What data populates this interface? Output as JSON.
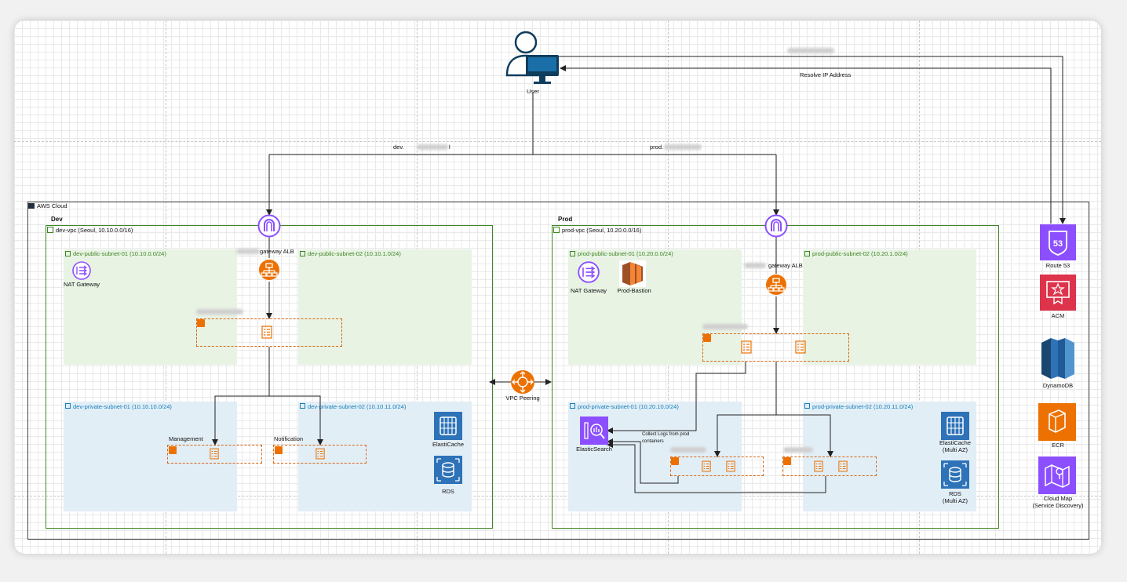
{
  "user": {
    "label": "User"
  },
  "edges": {
    "resolve_ip": "Resolve IP Address",
    "dev_domain": "dev.",
    "dev_domain_tail": "l",
    "prod_domain": "prod.",
    "collect_logs_line1": "Collect Logs from prod",
    "collect_logs_line2": "containers"
  },
  "aws_cloud": {
    "label": "AWS Cloud"
  },
  "dev": {
    "env_label": "Dev",
    "vpc_label": "dev-vpc (Seoul, 10.10.0.0/16)",
    "public_subnet_1": "dev-public-subnet-01 (10.10.0.0/24)",
    "public_subnet_2": "dev-public-subnet-02 (10.10.1.0/24)",
    "private_subnet_1": "dev-private-subnet-01 (10.10.10.0/24)",
    "private_subnet_2": "dev-private-subnet-02 (10.10.11.0/24)",
    "nat_gateway": "NAT Gateway",
    "alb": "gateway ALB",
    "management": "Management",
    "notification": "Notification",
    "elasticache": "ElastiCache",
    "rds": "RDS"
  },
  "prod": {
    "env_label": "Prod",
    "vpc_label": "prod-vpc (Seoul, 10.20.0.0/16)",
    "public_subnet_1": "prod-public-subnet-01 (10.20.0.0/24)",
    "public_subnet_2": "prod-public-subnet-02 (10.20.1.0/24)",
    "private_subnet_1": "prod-private-subnet-01 (10.20.10.0/24)",
    "private_subnet_2": "prod-private-subnet-02 (10.20.11.0/24)",
    "nat_gateway": "NAT Gateway",
    "bastion": "Prod-Bastion",
    "alb": "gateway ALB",
    "elasticsearch": "ElasticSearch",
    "elasticache_line1": "ElastiCache",
    "elasticache_line2": "(Multi AZ)",
    "rds_line1": "RDS",
    "rds_line2": "(Multi AZ)"
  },
  "vpc_peering": "VPC Peering",
  "global_services": {
    "route53": "Route 53",
    "acm": "ACM",
    "dynamodb": "DynamoDB",
    "ecr": "ECR",
    "cloudmap_line1": "Cloud Map",
    "cloudmap_line2": "(Service Discovery)"
  },
  "colors": {
    "vpc_green": "#3f8624",
    "public_subnet_fill": "#e8f3e4",
    "private_subnet_fill": "#e2eef6",
    "private_subnet_text": "#147eba",
    "compute_orange": "#ed7100",
    "network_purple": "#8c4fff",
    "security_red": "#dd344c",
    "database_blue": "#2e73b8",
    "user_navy": "#0f3d5e"
  }
}
